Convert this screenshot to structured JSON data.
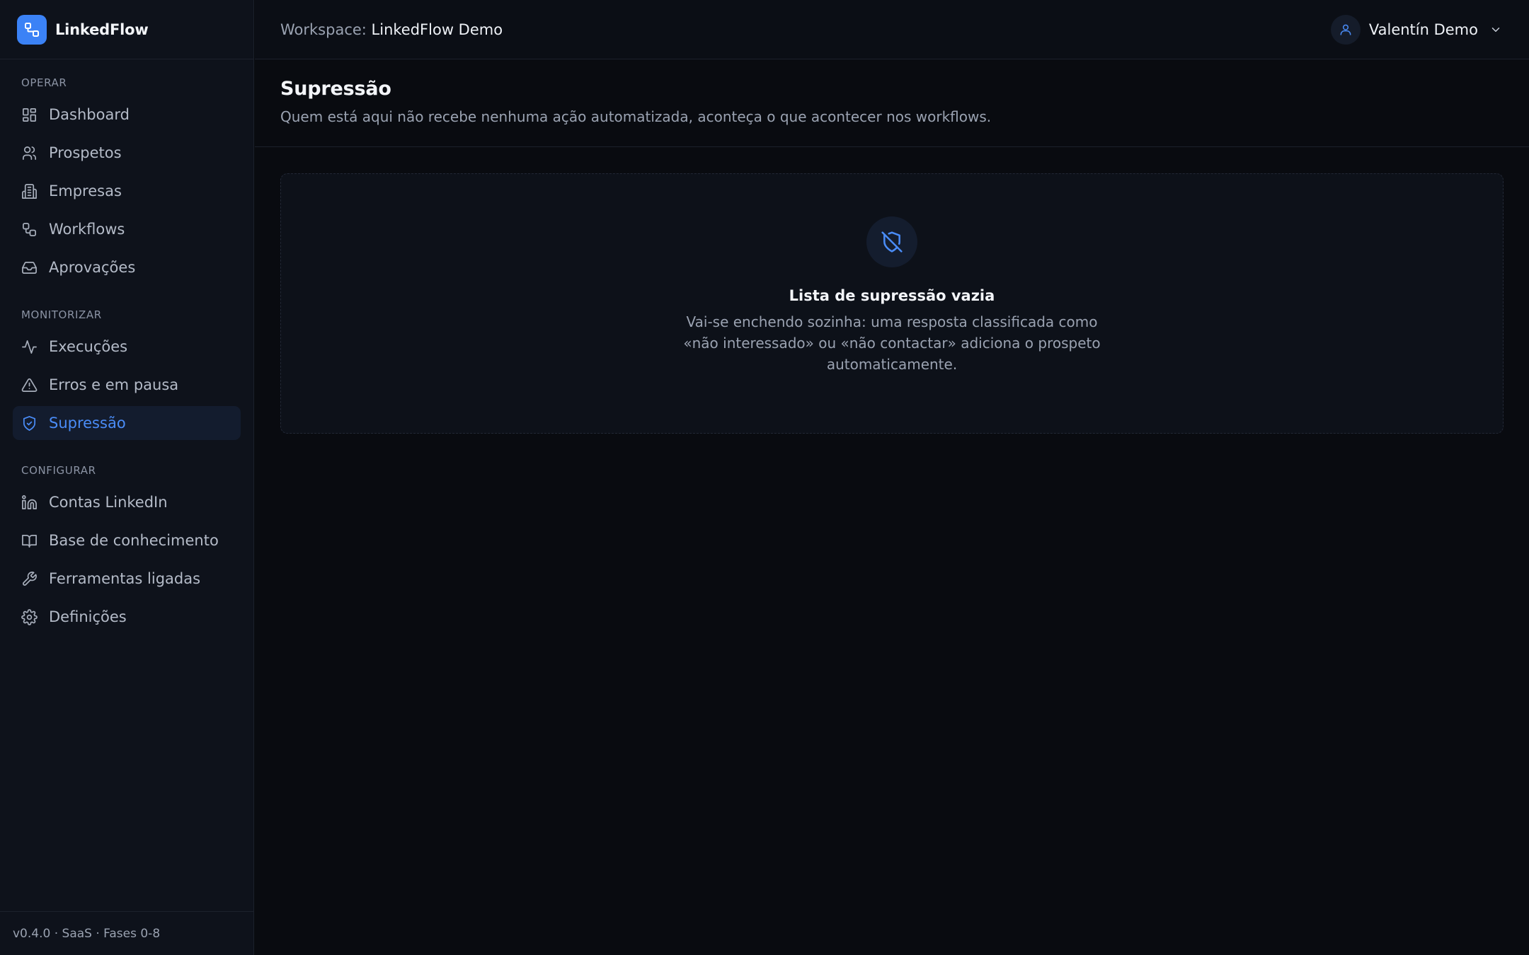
{
  "app": {
    "name": "LinkedFlow",
    "version": "v0.4.0 · SaaS · Fases 0-8"
  },
  "topbar": {
    "workspace_label": "Workspace:",
    "workspace_name": "LinkedFlow Demo",
    "user_name": "Valentín Demo"
  },
  "sidebar": {
    "sections": [
      {
        "label": "OPERAR",
        "items": [
          {
            "label": "Dashboard",
            "icon": "dashboard-icon"
          },
          {
            "label": "Prospetos",
            "icon": "users-icon"
          },
          {
            "label": "Empresas",
            "icon": "building-icon"
          },
          {
            "label": "Workflows",
            "icon": "workflow-icon"
          },
          {
            "label": "Aprovações",
            "icon": "inbox-icon"
          }
        ]
      },
      {
        "label": "MONITORIZAR",
        "items": [
          {
            "label": "Execuções",
            "icon": "activity-icon"
          },
          {
            "label": "Erros e em pausa",
            "icon": "warning-icon"
          },
          {
            "label": "Supressão",
            "icon": "shield-check-icon",
            "active": true
          }
        ]
      },
      {
        "label": "CONFIGURAR",
        "items": [
          {
            "label": "Contas LinkedIn",
            "icon": "linkedin-icon"
          },
          {
            "label": "Base de conhecimento",
            "icon": "book-icon"
          },
          {
            "label": "Ferramentas ligadas",
            "icon": "wrench-icon"
          },
          {
            "label": "Definições",
            "icon": "gear-icon"
          }
        ]
      }
    ]
  },
  "page": {
    "title": "Supressão",
    "subtitle": "Quem está aqui não recebe nenhuma ação automatizada, aconteça o que acontecer nos workflows."
  },
  "empty_state": {
    "icon": "shield-off-icon",
    "title": "Lista de supressão vazia",
    "description": "Vai-se enchendo sozinha: uma resposta classificada como «não interessado» ou «não contactar» adiciona o prospeto automaticamente."
  },
  "colors": {
    "accent": "#3b82f6",
    "background": "#090b10",
    "sidebar": "#0e121b"
  }
}
